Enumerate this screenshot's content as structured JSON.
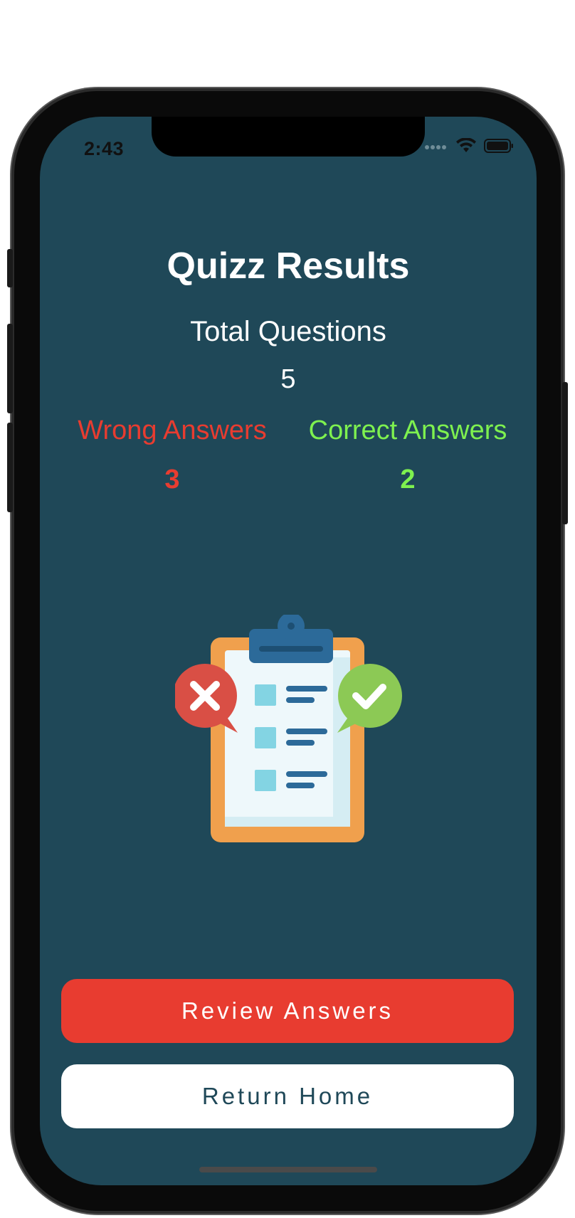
{
  "status_bar": {
    "time": "2:43"
  },
  "results": {
    "title": "Quizz Results",
    "total_label": "Total Questions",
    "total_value": "5",
    "wrong_label": "Wrong Answers",
    "wrong_value": "3",
    "correct_label": "Correct Answers",
    "correct_value": "2"
  },
  "buttons": {
    "review_label": "Review Answers",
    "home_label": "Return Home"
  },
  "icons": {
    "signal": "cellular-signal-icon",
    "wifi": "wifi-icon",
    "battery": "battery-icon",
    "illustration": "clipboard-checklist-icon",
    "wrong": "cross-bubble-icon",
    "correct": "check-bubble-icon"
  },
  "colors": {
    "background": "#1f4858",
    "wrong": "#e83c30",
    "correct": "#7ef14f",
    "white": "#ffffff"
  }
}
